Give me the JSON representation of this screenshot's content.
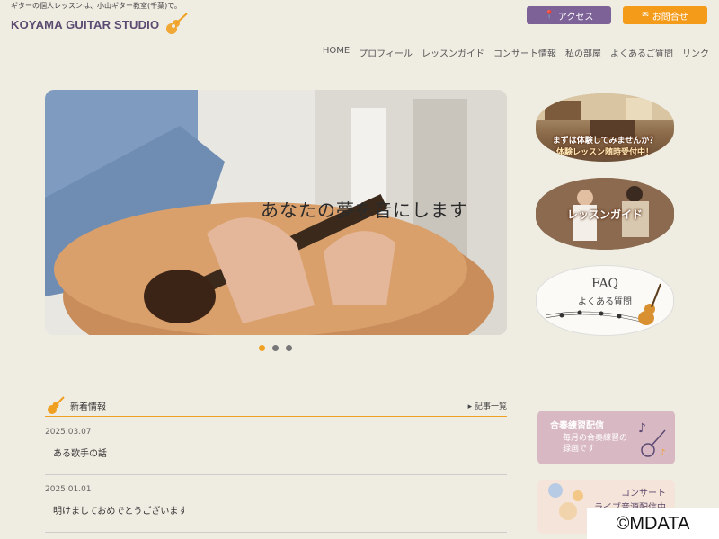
{
  "header": {
    "tagline": "ギターの個人レッスンは、小山ギター教室(千葉)で。",
    "logo_text": "KOYAMA GUITAR STUDIO",
    "access_label": "アクセス",
    "contact_label": "お問合せ"
  },
  "nav": [
    "HOME",
    "プロフィール",
    "レッスンガイド",
    "コンサート情報",
    "私の部屋",
    "よくあるご質問",
    "リンク"
  ],
  "hero": {
    "caption": "あなたの夢を音にします",
    "slides_total": 3,
    "active_slide": 1
  },
  "side_cards": {
    "trial_line1": "まずは体験してみませんか？",
    "trial_line2": "体験レッスン随時受付中！",
    "lesson_guide": "レッスンガイド",
    "faq_title": "FAQ",
    "faq_sub": "よくある質問"
  },
  "news": {
    "heading": "新着情報",
    "all_link": "記事一覧",
    "items": [
      {
        "date": "2025.03.07",
        "title": "ある歌手の話"
      },
      {
        "date": "2025.01.01",
        "title": "明けましておめでとうございます"
      }
    ]
  },
  "promos": {
    "ensemble_title": "合奏練習配信",
    "ensemble_body_1": "毎月の合奏練習の",
    "ensemble_body_2": "録画です",
    "concert_title": "コンサート",
    "concert_sub": "ライブ音源配信中"
  },
  "watermark": "©MDATA",
  "colors": {
    "background": "#efece2",
    "brand_purple": "#7c6296",
    "accent_orange": "#f49b1a"
  }
}
